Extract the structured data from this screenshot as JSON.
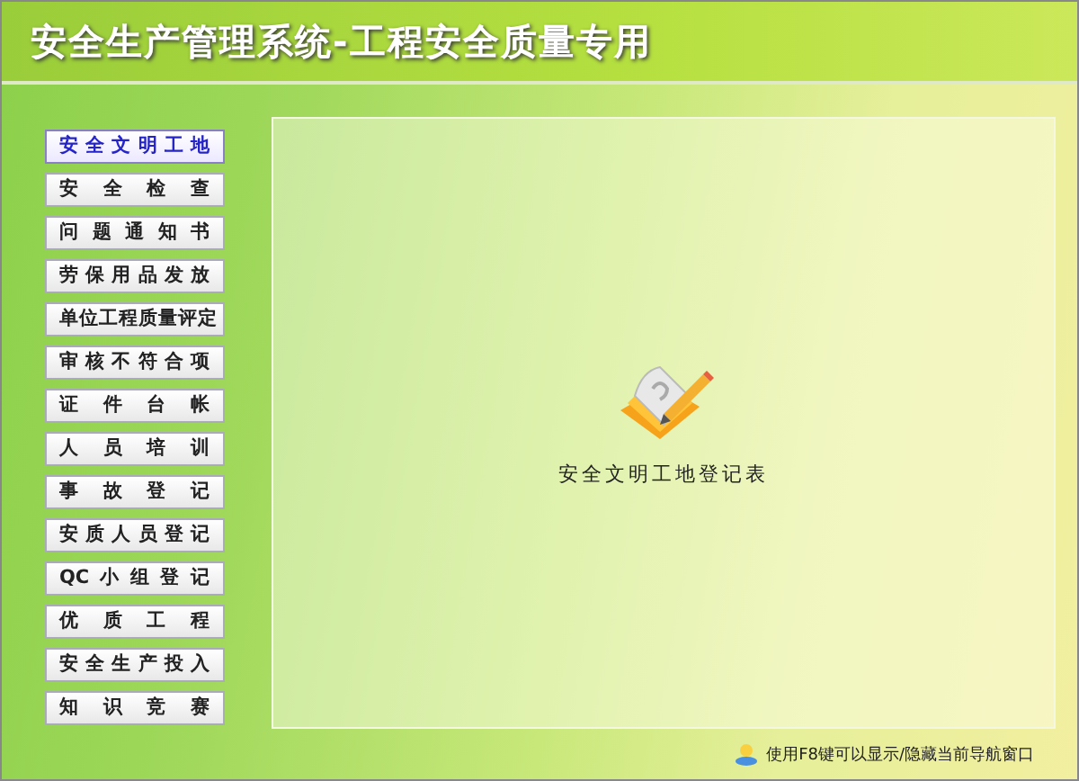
{
  "window": {
    "title": "安全生产管理系统-工程安全质量专用"
  },
  "nav": [
    {
      "label": "安全文明工地",
      "selected": true
    },
    {
      "label": "安全检查",
      "selected": false
    },
    {
      "label": "问题通知书",
      "selected": false
    },
    {
      "label": "劳保用品发放",
      "selected": false
    },
    {
      "label": "单位工程质量评定",
      "selected": false
    },
    {
      "label": "审核不符合项",
      "selected": false
    },
    {
      "label": "证件台帐",
      "selected": false
    },
    {
      "label": "人员培训",
      "selected": false
    },
    {
      "label": "事故登记",
      "selected": false
    },
    {
      "label": "安质人员登记",
      "selected": false
    },
    {
      "label": "QC小组登记",
      "selected": false
    },
    {
      "label": "优质工程",
      "selected": false
    },
    {
      "label": "安全生产投入",
      "selected": false
    },
    {
      "label": "知识竞赛",
      "selected": false
    }
  ],
  "content": {
    "item_label": "安全文明工地登记表"
  },
  "status_bar": {
    "hint": "使用F8键可以显示/隐藏当前导航窗口"
  }
}
